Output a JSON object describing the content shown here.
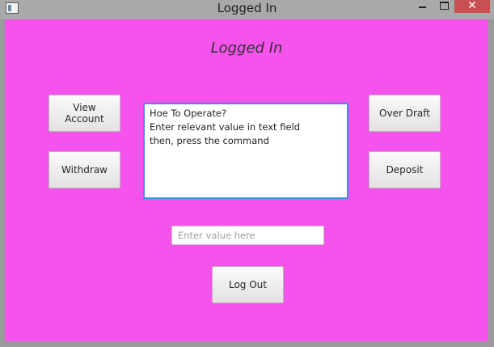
{
  "window": {
    "title": "Logged In",
    "close_glyph": "✕"
  },
  "main": {
    "heading": "Logged In",
    "buttons": {
      "view_account": "View Account",
      "withdraw": "Withdraw",
      "over_draft": "Over Draft",
      "deposit": "Deposit",
      "log_out": "Log Out"
    },
    "instructions": [
      "Hoe To Operate?",
      "Enter relevant value in text field",
      "then, press the command"
    ],
    "value_input": {
      "value": "",
      "placeholder": "Enter value here"
    }
  },
  "colors": {
    "background": "#f553ec",
    "focus_border": "#3d8ee8",
    "close_button": "#c75050"
  }
}
